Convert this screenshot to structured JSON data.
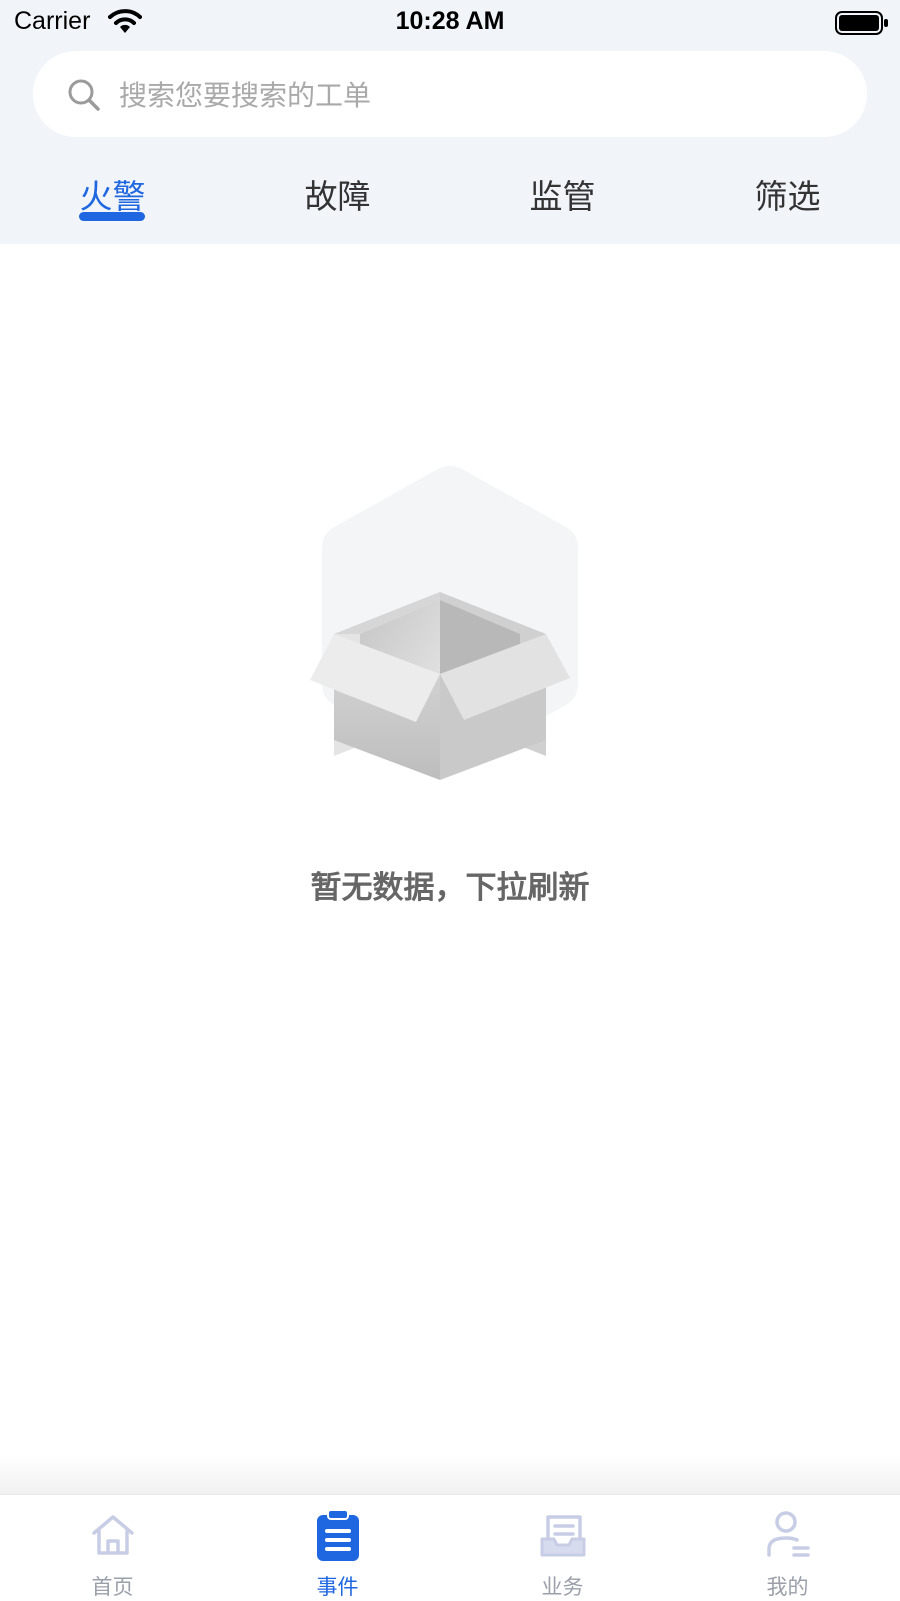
{
  "status_bar": {
    "carrier": "Carrier",
    "time": "10:28 AM"
  },
  "search": {
    "placeholder": "搜索您要搜索的工单",
    "value": ""
  },
  "tabs": [
    {
      "label": "火警",
      "active": true
    },
    {
      "label": "故障",
      "active": false
    },
    {
      "label": "监管",
      "active": false
    },
    {
      "label": "筛选",
      "active": false
    }
  ],
  "empty_state": {
    "icon": "empty-box-icon",
    "message": "暂无数据，下拉刷新"
  },
  "tabbar": {
    "items": [
      {
        "label": "首页",
        "icon": "home-icon",
        "active": false
      },
      {
        "label": "事件",
        "icon": "clipboard-icon",
        "active": true
      },
      {
        "label": "业务",
        "icon": "document-tray-icon",
        "active": false
      },
      {
        "label": "我的",
        "icon": "profile-icon",
        "active": false
      }
    ]
  },
  "colors": {
    "accent": "#1f67e0",
    "header_bg": "#f1f5f9",
    "inactive_icon": "#c8cde6",
    "muted_text": "#9aa0aa"
  }
}
